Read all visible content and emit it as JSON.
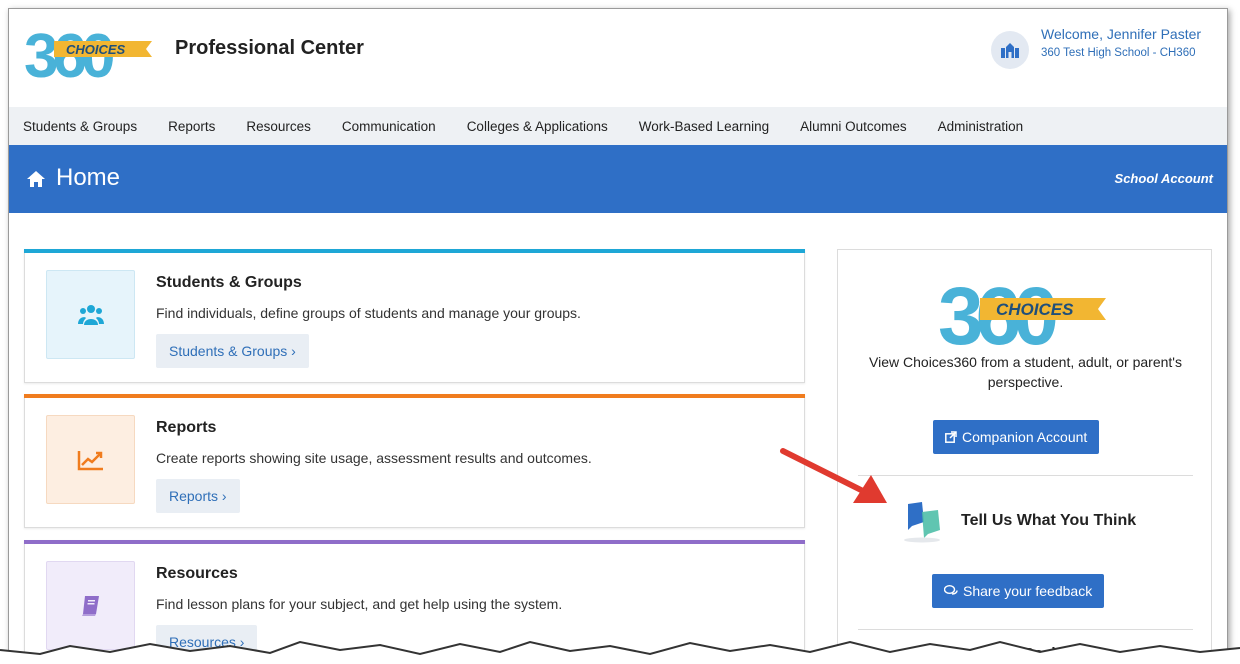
{
  "header": {
    "logo_text": "CHOICES",
    "logo_number": "360",
    "app_title": "Professional Center",
    "welcome": "Welcome, Jennifer Paster",
    "school": "360 Test High School - CH360",
    "avatar_icon": "school-building-icon"
  },
  "nav": {
    "items": [
      "Students & Groups",
      "Reports",
      "Resources",
      "Communication",
      "Colleges & Applications",
      "Work-Based Learning",
      "Alumni Outcomes",
      "Administration"
    ]
  },
  "page": {
    "title": "Home",
    "account_type": "School Account",
    "icon": "home-icon"
  },
  "cards": [
    {
      "title": "Students & Groups",
      "description": "Find individuals, define groups of students and manage your groups.",
      "button": "Students & Groups ›",
      "icon": "users-icon",
      "accent": "#1ea7d6",
      "tile_bg": "#e6f4fb"
    },
    {
      "title": "Reports",
      "description": "Create reports showing site usage, assessment results and outcomes.",
      "button": "Reports ›",
      "icon": "line-chart-icon",
      "accent": "#f07c1e",
      "tile_bg": "#fdeee1"
    },
    {
      "title": "Resources",
      "description": "Find lesson plans for your subject, and get help using the system.",
      "button": "Resources ›",
      "icon": "book-icon",
      "accent": "#8f6dc9",
      "tile_bg": "#f1ecfa"
    }
  ],
  "side": {
    "logo_text": "CHOICES",
    "logo_number": "360",
    "description": "View Choices360 from a student, adult, or parent's perspective.",
    "companion_button": "Companion Account",
    "feedback_title": "Tell Us What You Think",
    "feedback_button": "Share your feedback",
    "social_title": "Stay Social!"
  },
  "colors": {
    "primary": "#2f6fc6",
    "link": "#2f6fb8",
    "logo_blue": "#49b2d8",
    "logo_gold": "#f2b632"
  }
}
